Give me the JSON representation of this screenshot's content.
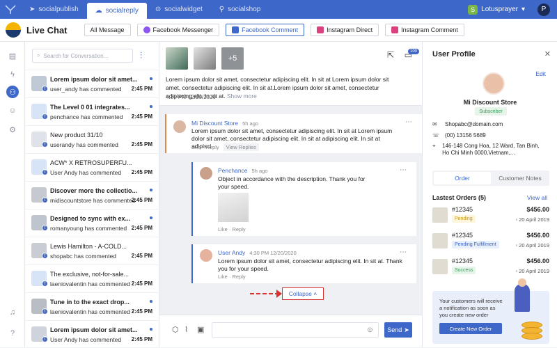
{
  "topbar": {
    "tabs": [
      {
        "label": "socialpublish"
      },
      {
        "label": "socialreply"
      },
      {
        "label": "socialwidget"
      },
      {
        "label": "socialshop"
      }
    ],
    "store_name": "Lotusprayer",
    "user_initial": "P"
  },
  "header": {
    "title": "Live Chat",
    "filters": [
      {
        "label": "All Message"
      },
      {
        "label": "Facebook Messenger"
      },
      {
        "label": "Facebook Comment"
      },
      {
        "label": "Instagram Direct"
      },
      {
        "label": "Instagram Comment"
      }
    ],
    "active_filter": "Facebook Comment"
  },
  "conversations": {
    "search_placeholder": "Search for Conversation...",
    "items": [
      {
        "title": "Lorem ipsum dolor sit amet...",
        "sub": "user_andy has commented",
        "time": "2:45 PM",
        "unread": true
      },
      {
        "title": "The Level 0 01 integrates...",
        "sub": "penchance has commented",
        "time": "2:45 PM",
        "unread": true
      },
      {
        "title": "New product 31/10",
        "sub": "userandy has commented",
        "time": "2:45 PM",
        "unread": false
      },
      {
        "title": "ACW* X RETROSUPERFU...",
        "sub": "User Andy has commented",
        "time": "2:45 PM",
        "unread": false
      },
      {
        "title": "Discover more the collectio...",
        "sub": "midiscountstore has commented",
        "time": "2:45 PM",
        "unread": true
      },
      {
        "title": "Designed to sync with ex...",
        "sub": "romanyoung has commented",
        "time": "2:45 PM",
        "unread": true
      },
      {
        "title": "Lewis Hamilton - A-COLD...",
        "sub": "shopabc has commented",
        "time": "2:45 PM",
        "unread": false
      },
      {
        "title": "The exclusive, not-for-sale...",
        "sub": "laeniovalentin has commented",
        "time": "2:45 PM",
        "unread": false
      },
      {
        "title": "Tune in to the exact drop...",
        "sub": "laeniovalentin has commented",
        "time": "2:45 PM",
        "unread": true
      },
      {
        "title": "Lorem ipsum dolor sit amet...",
        "sub": "User Andy has commented",
        "time": "2:45 PM",
        "unread": true
      }
    ]
  },
  "post": {
    "more_label": "+5",
    "badge": "100",
    "text": "Lorem ipsum dolor sit amet, consectetur adipiscing elit. In sit at Lorem ipsum dolor sit amet, consectetur adipiscing elit. In sit at.Lorem ipsum dolor sit amet, consectetur adipiscing elit. In sit at.",
    "show_more": "Show more",
    "date": "4:30 PM 12/20/2020"
  },
  "comments": {
    "c1": {
      "name": "Mi Discount Store",
      "time": "5h ago",
      "text": "Lorem ipsum dolor sit amet, consectetur adipiscing elit. In sit at Lorem ipsum dolor sit amet, consectetur adipiscing elit. In sit at adipiscing elit. In sit at adipisci",
      "like": "Like",
      "reply": "Reply",
      "view_replies": "View Replies"
    },
    "c2": {
      "name": "Penchance",
      "time": "5h ago",
      "text": "Object in accordance with the description. Thank you for your speed.",
      "like": "Like",
      "reply": "Reply"
    },
    "c3": {
      "name": "User Andy",
      "time": "4:30 PM 12/20/2020",
      "text": "Lorem ipsum dolor sit amet, consectetur adipiscing elit. In sit at. Thank you for your speed.",
      "like": "Like",
      "reply": "Reply"
    },
    "collapse_label": "Collapse"
  },
  "composer": {
    "send_label": "Send"
  },
  "profile": {
    "title": "User Profile",
    "edit_label": "Edit",
    "name": "Mi Discount Store",
    "status": "Subscriber",
    "email": "Shopabc@domain.com",
    "phone": "(00) 13156 5689",
    "address": "146-148 Cong Hoa, 12 Ward, Tan Binh, Ho Chi Minh 0000,Vietnam,...",
    "tabs": [
      {
        "label": "Order"
      },
      {
        "label": "Customer Notes"
      }
    ],
    "orders_title": "Lastest Orders (5)",
    "view_all": "View all",
    "orders": [
      {
        "id": "#12345",
        "price": "$456.00",
        "status": "Pending",
        "date": "20 April 2019"
      },
      {
        "id": "#12345",
        "price": "$456.00",
        "status": "Pending Fulfillment",
        "date": "20 April 2019"
      },
      {
        "id": "#12345",
        "price": "$456.00",
        "status": "Success",
        "date": "20 April 2019"
      }
    ],
    "promo_text": "Your customers will receive a notification as soon as you create new order",
    "promo_button": "Create New Order"
  },
  "colors": {
    "accent": "#3d67c8",
    "highlight": "#d93030"
  }
}
